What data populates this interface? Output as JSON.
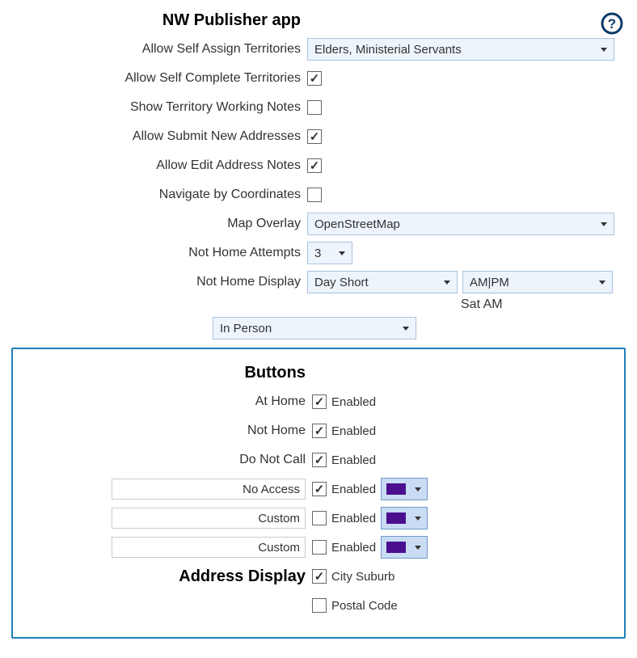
{
  "header": {
    "title": "NW Publisher app"
  },
  "settings": {
    "allow_self_assign_territories_label": "Allow Self Assign Territories",
    "allow_self_assign_territories_value": "Elders, Ministerial Servants",
    "allow_self_complete_territories_label": "Allow Self Complete Territories",
    "allow_self_complete_territories_checked": true,
    "show_territory_working_notes_label": "Show Territory Working Notes",
    "show_territory_working_notes_checked": false,
    "allow_submit_new_addresses_label": "Allow Submit New Addresses",
    "allow_submit_new_addresses_checked": true,
    "allow_edit_address_notes_label": "Allow Edit Address Notes",
    "allow_edit_address_notes_checked": true,
    "navigate_by_coordinates_label": "Navigate by Coordinates",
    "navigate_by_coordinates_checked": false,
    "map_overlay_label": "Map Overlay",
    "map_overlay_value": "OpenStreetMap",
    "not_home_attempts_label": "Not Home Attempts",
    "not_home_attempts_value": "3",
    "not_home_display_label": "Not Home Display",
    "not_home_display_day_value": "Day Short",
    "not_home_display_time_value": "AM|PM",
    "not_home_display_example": "Sat AM",
    "contact_method_value": "In Person"
  },
  "buttons_panel": {
    "title": "Buttons",
    "enabled_text": "Enabled",
    "rows": [
      {
        "label": "At Home",
        "has_input": false,
        "checked": true,
        "has_color": false
      },
      {
        "label": "Not Home",
        "has_input": false,
        "checked": true,
        "has_color": false
      },
      {
        "label": "Do Not Call",
        "has_input": false,
        "checked": true,
        "has_color": false
      },
      {
        "label": "No Access",
        "has_input": true,
        "checked": true,
        "has_color": true,
        "color": "#4a0e8f"
      },
      {
        "label": "Custom",
        "has_input": true,
        "checked": false,
        "has_color": true,
        "color": "#4a0e8f"
      },
      {
        "label": "Custom",
        "has_input": true,
        "checked": false,
        "has_color": true,
        "color": "#4a0e8f"
      }
    ],
    "address_display_title": "Address Display",
    "city_suburb_label": "City Suburb",
    "city_suburb_checked": true,
    "postal_code_label": "Postal Code",
    "postal_code_checked": false
  }
}
